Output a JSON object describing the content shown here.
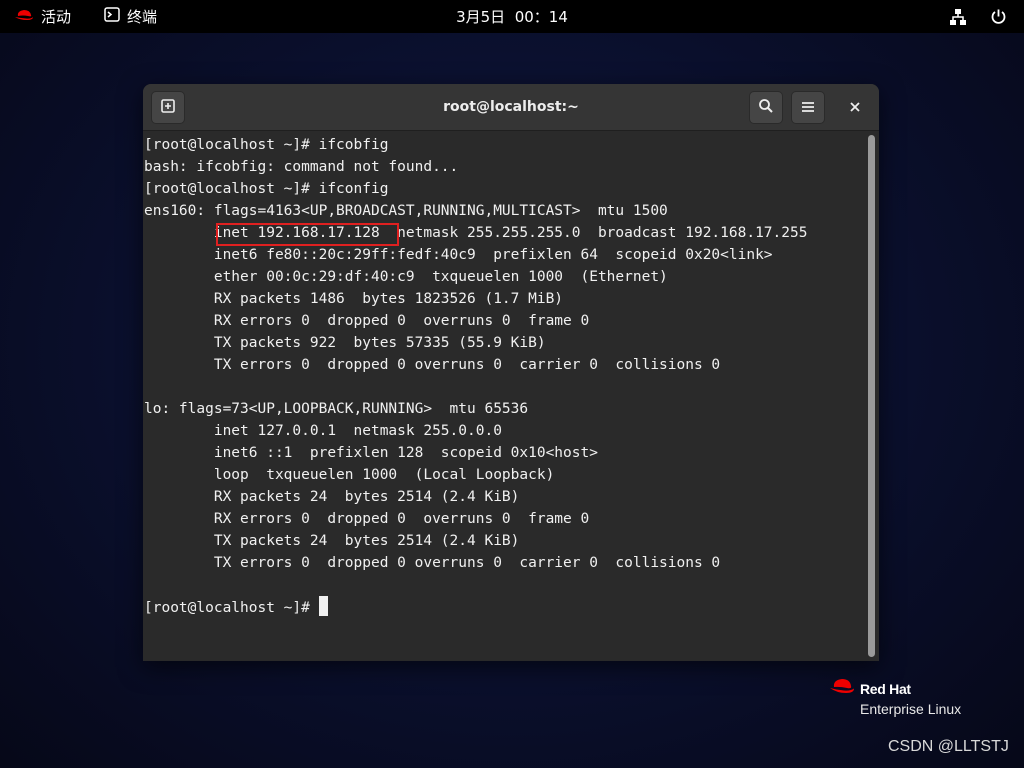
{
  "topbar": {
    "activities_label": "活动",
    "terminal_app_label": "终端",
    "clock": "3月5日  00：14",
    "network_icon": "network-icon",
    "power_icon": "power-icon"
  },
  "window": {
    "title": "root@localhost:~",
    "buttons": [
      "new-tab-icon",
      "search-icon",
      "menu-icon",
      "close-icon"
    ]
  },
  "terminal": {
    "lines": [
      "[root@localhost ~]# ifcobfig",
      "bash: ifcobfig: command not found...",
      "[root@localhost ~]# ifconfig",
      "ens160: flags=4163<UP,BROADCAST,RUNNING,MULTICAST>  mtu 1500",
      "        inet 192.168.17.128  netmask 255.255.255.0  broadcast 192.168.17.255",
      "        inet6 fe80::20c:29ff:fedf:40c9  prefixlen 64  scopeid 0x20<link>",
      "        ether 00:0c:29:df:40:c9  txqueuelen 1000  (Ethernet)",
      "        RX packets 1486  bytes 1823526 (1.7 MiB)",
      "        RX errors 0  dropped 0  overruns 0  frame 0",
      "        TX packets 922  bytes 57335 (55.9 KiB)",
      "        TX errors 0  dropped 0 overruns 0  carrier 0  collisions 0",
      "",
      "lo: flags=73<UP,LOOPBACK,RUNNING>  mtu 65536",
      "        inet 127.0.0.1  netmask 255.0.0.0",
      "        inet6 ::1  prefixlen 128  scopeid 0x10<host>",
      "        loop  txqueuelen 1000  (Local Loopback)",
      "        RX packets 24  bytes 2514 (2.4 KiB)",
      "        RX errors 0  dropped 0  overruns 0  frame 0",
      "        TX packets 24  bytes 2514 (2.4 KiB)",
      "        TX errors 0  dropped 0 overruns 0  carrier 0  collisions 0",
      ""
    ],
    "prompt": "[root@localhost ~]# ",
    "highlight_color": "#e02020"
  },
  "brand": {
    "line1": "Red Hat",
    "line2": "Enterprise Linux",
    "color": "#ee0000"
  },
  "watermark": "CSDN @LLTSTJ"
}
